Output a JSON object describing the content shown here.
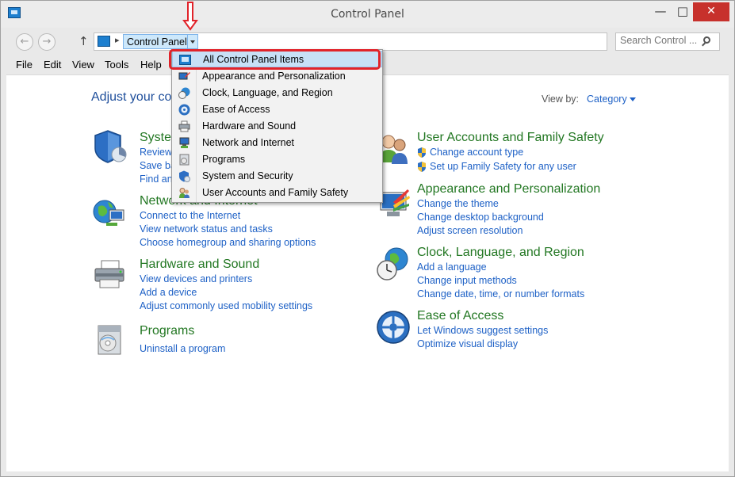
{
  "window": {
    "title": "Control Panel"
  },
  "address": {
    "crumb": "Control Panel"
  },
  "search": {
    "placeholder": "Search Control ..."
  },
  "menu": [
    "File",
    "Edit",
    "View",
    "Tools",
    "Help"
  ],
  "main": {
    "heading": "Adjust your co",
    "view_by_label": "View by:",
    "view_by_value": "Category"
  },
  "categories": {
    "system": {
      "title": "Syster",
      "links": [
        "Review",
        "Save ba",
        "Find an"
      ]
    },
    "network": {
      "title": "Network and Internet",
      "links": [
        "Connect to the Internet",
        "View network status and tasks",
        "Choose homegroup and sharing options"
      ]
    },
    "hardware": {
      "title": "Hardware and Sound",
      "links": [
        "View devices and printers",
        "Add a device",
        "Adjust commonly used mobility settings"
      ]
    },
    "programs": {
      "title": "Programs",
      "links": [
        "Uninstall a program"
      ]
    },
    "user_accounts": {
      "title": "User Accounts and Family Safety",
      "links": [
        "Change account type",
        "Set up Family Safety for any user"
      ]
    },
    "appearance": {
      "title": "Appearance and Personalization",
      "links": [
        "Change the theme",
        "Change desktop background",
        "Adjust screen resolution"
      ]
    },
    "clock": {
      "title": "Clock, Language, and Region",
      "links": [
        "Add a language",
        "Change input methods",
        "Change date, time, or number formats"
      ]
    },
    "ease": {
      "title": "Ease of Access",
      "links": [
        "Let Windows suggest settings",
        "Optimize visual display"
      ]
    }
  },
  "dropdown": {
    "items": [
      "All Control Panel Items",
      "Appearance and Personalization",
      "Clock, Language, and Region",
      "Ease of Access",
      "Hardware and Sound",
      "Network and Internet",
      "Programs",
      "System and Security",
      "User Accounts and Family Safety"
    ],
    "selected_index": 0
  },
  "colors": {
    "link_blue": "#1e61c6",
    "category_green": "#227722",
    "heading_blue": "#1e4e9b",
    "close_red": "#c7312c",
    "annotation_red": "#e1232a",
    "selection_blue": "#c7e0f6"
  },
  "icons": {
    "app": "control-panel-icon",
    "back": "back-arrow-icon",
    "forward": "forward-arrow-icon",
    "up": "up-arrow-icon",
    "refresh": "refresh-icon",
    "search": "search-icon",
    "annotation": "red-arrow-icon"
  }
}
